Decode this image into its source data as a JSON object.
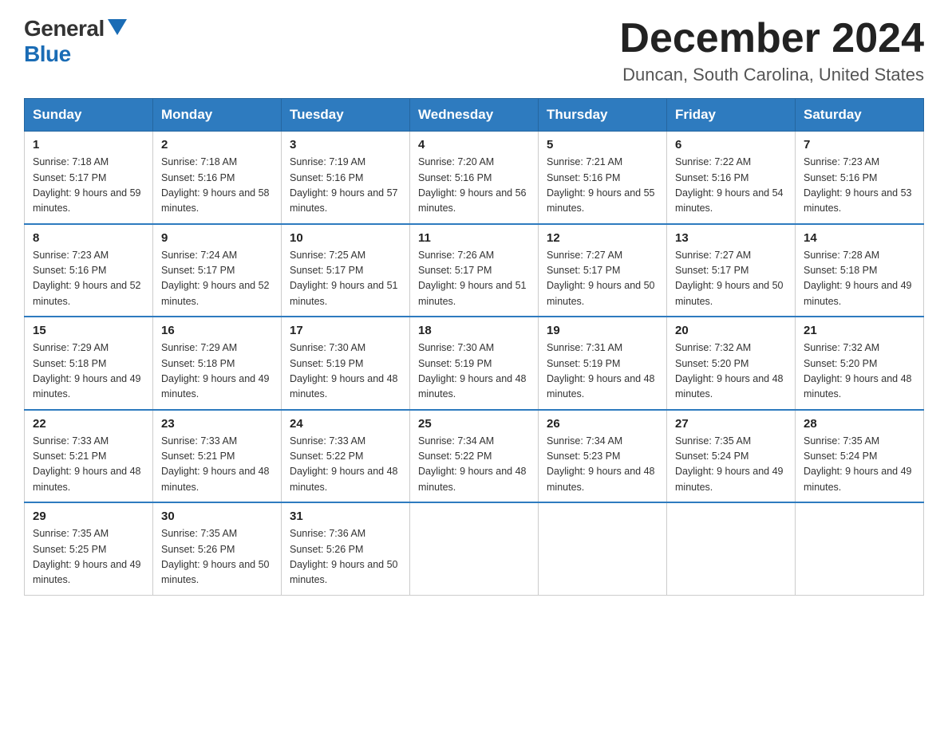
{
  "logo": {
    "general": "General",
    "blue": "Blue"
  },
  "title": "December 2024",
  "location": "Duncan, South Carolina, United States",
  "days_of_week": [
    "Sunday",
    "Monday",
    "Tuesday",
    "Wednesday",
    "Thursday",
    "Friday",
    "Saturday"
  ],
  "weeks": [
    [
      {
        "day": "1",
        "sunrise": "7:18 AM",
        "sunset": "5:17 PM",
        "daylight": "9 hours and 59 minutes."
      },
      {
        "day": "2",
        "sunrise": "7:18 AM",
        "sunset": "5:16 PM",
        "daylight": "9 hours and 58 minutes."
      },
      {
        "day": "3",
        "sunrise": "7:19 AM",
        "sunset": "5:16 PM",
        "daylight": "9 hours and 57 minutes."
      },
      {
        "day": "4",
        "sunrise": "7:20 AM",
        "sunset": "5:16 PM",
        "daylight": "9 hours and 56 minutes."
      },
      {
        "day": "5",
        "sunrise": "7:21 AM",
        "sunset": "5:16 PM",
        "daylight": "9 hours and 55 minutes."
      },
      {
        "day": "6",
        "sunrise": "7:22 AM",
        "sunset": "5:16 PM",
        "daylight": "9 hours and 54 minutes."
      },
      {
        "day": "7",
        "sunrise": "7:23 AM",
        "sunset": "5:16 PM",
        "daylight": "9 hours and 53 minutes."
      }
    ],
    [
      {
        "day": "8",
        "sunrise": "7:23 AM",
        "sunset": "5:16 PM",
        "daylight": "9 hours and 52 minutes."
      },
      {
        "day": "9",
        "sunrise": "7:24 AM",
        "sunset": "5:17 PM",
        "daylight": "9 hours and 52 minutes."
      },
      {
        "day": "10",
        "sunrise": "7:25 AM",
        "sunset": "5:17 PM",
        "daylight": "9 hours and 51 minutes."
      },
      {
        "day": "11",
        "sunrise": "7:26 AM",
        "sunset": "5:17 PM",
        "daylight": "9 hours and 51 minutes."
      },
      {
        "day": "12",
        "sunrise": "7:27 AM",
        "sunset": "5:17 PM",
        "daylight": "9 hours and 50 minutes."
      },
      {
        "day": "13",
        "sunrise": "7:27 AM",
        "sunset": "5:17 PM",
        "daylight": "9 hours and 50 minutes."
      },
      {
        "day": "14",
        "sunrise": "7:28 AM",
        "sunset": "5:18 PM",
        "daylight": "9 hours and 49 minutes."
      }
    ],
    [
      {
        "day": "15",
        "sunrise": "7:29 AM",
        "sunset": "5:18 PM",
        "daylight": "9 hours and 49 minutes."
      },
      {
        "day": "16",
        "sunrise": "7:29 AM",
        "sunset": "5:18 PM",
        "daylight": "9 hours and 49 minutes."
      },
      {
        "day": "17",
        "sunrise": "7:30 AM",
        "sunset": "5:19 PM",
        "daylight": "9 hours and 48 minutes."
      },
      {
        "day": "18",
        "sunrise": "7:30 AM",
        "sunset": "5:19 PM",
        "daylight": "9 hours and 48 minutes."
      },
      {
        "day": "19",
        "sunrise": "7:31 AM",
        "sunset": "5:19 PM",
        "daylight": "9 hours and 48 minutes."
      },
      {
        "day": "20",
        "sunrise": "7:32 AM",
        "sunset": "5:20 PM",
        "daylight": "9 hours and 48 minutes."
      },
      {
        "day": "21",
        "sunrise": "7:32 AM",
        "sunset": "5:20 PM",
        "daylight": "9 hours and 48 minutes."
      }
    ],
    [
      {
        "day": "22",
        "sunrise": "7:33 AM",
        "sunset": "5:21 PM",
        "daylight": "9 hours and 48 minutes."
      },
      {
        "day": "23",
        "sunrise": "7:33 AM",
        "sunset": "5:21 PM",
        "daylight": "9 hours and 48 minutes."
      },
      {
        "day": "24",
        "sunrise": "7:33 AM",
        "sunset": "5:22 PM",
        "daylight": "9 hours and 48 minutes."
      },
      {
        "day": "25",
        "sunrise": "7:34 AM",
        "sunset": "5:22 PM",
        "daylight": "9 hours and 48 minutes."
      },
      {
        "day": "26",
        "sunrise": "7:34 AM",
        "sunset": "5:23 PM",
        "daylight": "9 hours and 48 minutes."
      },
      {
        "day": "27",
        "sunrise": "7:35 AM",
        "sunset": "5:24 PM",
        "daylight": "9 hours and 49 minutes."
      },
      {
        "day": "28",
        "sunrise": "7:35 AM",
        "sunset": "5:24 PM",
        "daylight": "9 hours and 49 minutes."
      }
    ],
    [
      {
        "day": "29",
        "sunrise": "7:35 AM",
        "sunset": "5:25 PM",
        "daylight": "9 hours and 49 minutes."
      },
      {
        "day": "30",
        "sunrise": "7:35 AM",
        "sunset": "5:26 PM",
        "daylight": "9 hours and 50 minutes."
      },
      {
        "day": "31",
        "sunrise": "7:36 AM",
        "sunset": "5:26 PM",
        "daylight": "9 hours and 50 minutes."
      },
      null,
      null,
      null,
      null
    ]
  ]
}
